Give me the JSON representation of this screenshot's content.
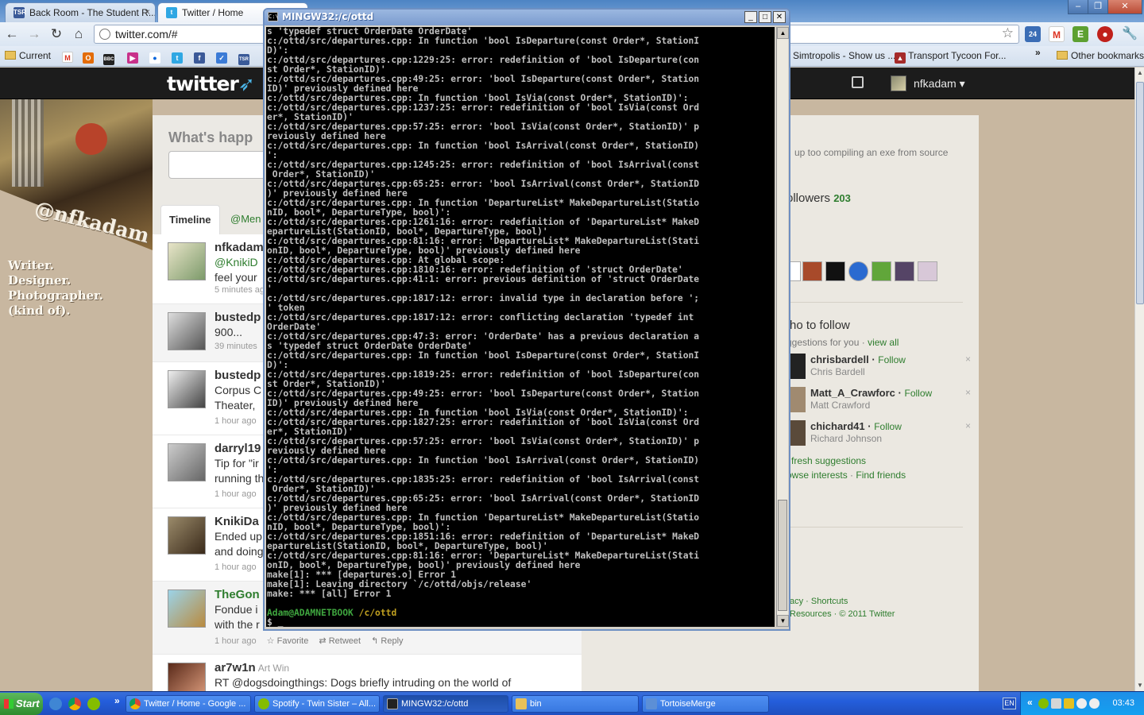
{
  "browser": {
    "tabs": [
      {
        "label": "Back Room - The Student R...",
        "icon": "tsr-icon",
        "color": "#3a5a98"
      },
      {
        "label": "Twitter / Home",
        "icon": "twitter-bird-icon",
        "color": "#2fa7e3"
      }
    ],
    "url": "twitter.com/#",
    "bookmarks": {
      "current": "Current",
      "simtropolis": "Simtropolis - Show us ...",
      "transport": "Transport Tycoon For...",
      "chevron": "»",
      "other": "Other bookmarks"
    },
    "extension_badge": "24"
  },
  "twitter": {
    "logo": "twitter",
    "account": "nfkadam",
    "profile": {
      "handle": "@nfkadam",
      "bio_lines": [
        "Writer.",
        "Designer.",
        "Photographer.",
        "(kind of)."
      ]
    },
    "whats_happening": "What's happ",
    "tabs": {
      "timeline": "Timeline",
      "mentions": "@Men"
    },
    "tweets": [
      {
        "name": "nfkadam",
        "lines": [
          "@KnikiD",
          "feel your"
        ],
        "time": "5 minutes ag",
        "highlight": false
      },
      {
        "name": "bustedp",
        "lines": [
          "900..."
        ],
        "time": "39 minutes",
        "highlight": true
      },
      {
        "name": "bustedp",
        "lines": [
          "Corpus C",
          "Theater,"
        ],
        "time": "1 hour ago",
        "highlight": false
      },
      {
        "name": "darryl19",
        "lines": [
          "Tip for \"ir",
          "running th"
        ],
        "time": "1 hour ago",
        "highlight": false
      },
      {
        "name": "KnikiDa",
        "lines": [
          "Ended up",
          "and doing"
        ],
        "time": "1 hour ago",
        "highlight": false
      },
      {
        "name": "TheGon",
        "lines": [
          "Fondue i",
          "with the r"
        ],
        "time": "1 hour ago",
        "highlight": true,
        "actions": [
          "Favorite",
          "Retweet",
          "Reply"
        ]
      },
      {
        "name": "ar7w1n",
        "realname": "Art Win",
        "lines": [
          "RT @dogsdoingthings: Dogs briefly intruding on the world of"
        ],
        "time": "",
        "highlight": false
      }
    ],
    "dashboard": {
      "latest_tweet_tail": "up too compiling an exe from source",
      "followers_label": "ollowers",
      "followers_count": "203",
      "who_to_follow": "ho to follow",
      "suggestions": "ggestions for you",
      "view_all": "view all",
      "follow_label": "Follow",
      "people": [
        {
          "user": "chrisbardell",
          "real": "Chris Bardell"
        },
        {
          "user": "Matt_A_Crawforc",
          "real": "Matt Crawford"
        },
        {
          "user": "chichard41",
          "real": "Richard Johnson"
        }
      ],
      "refresh": "fresh suggestions",
      "browse": "owse interests",
      "find_friends": "Find friends",
      "footer1": "acy · Shortcuts",
      "footer2": "Resources · © 2011 Twitter"
    }
  },
  "console": {
    "title": "MINGW32:/c/ottd",
    "lines": [
      "s 'typedef struct OrderDate OrderDate'",
      "c:/ottd/src/departures.cpp: In function 'bool IsDeparture(const Order*, StationI",
      "D)':",
      "c:/ottd/src/departures.cpp:1229:25: error: redefinition of 'bool IsDeparture(con",
      "st Order*, StationID)'",
      "c:/ottd/src/departures.cpp:49:25: error: 'bool IsDeparture(const Order*, Station",
      "ID)' previously defined here",
      "c:/ottd/src/departures.cpp: In function 'bool IsVia(const Order*, StationID)':",
      "c:/ottd/src/departures.cpp:1237:25: error: redefinition of 'bool IsVia(const Ord",
      "er*, StationID)'",
      "c:/ottd/src/departures.cpp:57:25: error: 'bool IsVia(const Order*, StationID)' p",
      "reviously defined here",
      "c:/ottd/src/departures.cpp: In function 'bool IsArrival(const Order*, StationID)",
      "':",
      "c:/ottd/src/departures.cpp:1245:25: error: redefinition of 'bool IsArrival(const",
      " Order*, StationID)'",
      "c:/ottd/src/departures.cpp:65:25: error: 'bool IsArrival(const Order*, StationID",
      ")' previously defined here",
      "c:/ottd/src/departures.cpp: In function 'DepartureList* MakeDepartureList(Statio",
      "nID, bool*, DepartureType, bool)':",
      "c:/ottd/src/departures.cpp:1261:16: error: redefinition of 'DepartureList* MakeD",
      "epartureList(StationID, bool*, DepartureType, bool)'",
      "c:/ottd/src/departures.cpp:81:16: error: 'DepartureList* MakeDepartureList(Stati",
      "onID, bool*, DepartureType, bool)' previously defined here",
      "c:/ottd/src/departures.cpp: At global scope:",
      "c:/ottd/src/departures.cpp:1810:16: error: redefinition of 'struct OrderDate'",
      "c:/ottd/src/departures.cpp:41:1: error: previous definition of 'struct OrderDate",
      "'",
      "c:/ottd/src/departures.cpp:1817:12: error: invalid type in declaration before ';",
      "' token",
      "c:/ottd/src/departures.cpp:1817:12: error: conflicting declaration 'typedef int",
      "OrderDate'",
      "c:/ottd/src/departures.cpp:47:3: error: 'OrderDate' has a previous declaration a",
      "s 'typedef struct OrderDate OrderDate'",
      "c:/ottd/src/departures.cpp: In function 'bool IsDeparture(const Order*, StationI",
      "D)':",
      "c:/ottd/src/departures.cpp:1819:25: error: redefinition of 'bool IsDeparture(con",
      "st Order*, StationID)'",
      "c:/ottd/src/departures.cpp:49:25: error: 'bool IsDeparture(const Order*, Station",
      "ID)' previously defined here",
      "c:/ottd/src/departures.cpp: In function 'bool IsVia(const Order*, StationID)':",
      "c:/ottd/src/departures.cpp:1827:25: error: redefinition of 'bool IsVia(const Ord",
      "er*, StationID)'",
      "c:/ottd/src/departures.cpp:57:25: error: 'bool IsVia(const Order*, StationID)' p",
      "reviously defined here",
      "c:/ottd/src/departures.cpp: In function 'bool IsArrival(const Order*, StationID)",
      "':",
      "c:/ottd/src/departures.cpp:1835:25: error: redefinition of 'bool IsArrival(const",
      " Order*, StationID)'",
      "c:/ottd/src/departures.cpp:65:25: error: 'bool IsArrival(const Order*, StationID",
      ")' previously defined here",
      "c:/ottd/src/departures.cpp: In function 'DepartureList* MakeDepartureList(Statio",
      "nID, bool*, DepartureType, bool)':",
      "c:/ottd/src/departures.cpp:1851:16: error: redefinition of 'DepartureList* MakeD",
      "epartureList(StationID, bool*, DepartureType, bool)'",
      "c:/ottd/src/departures.cpp:81:16: error: 'DepartureList* MakeDepartureList(Stati",
      "onID, bool*, DepartureType, bool)' previously defined here",
      "make[1]: *** [departures.o] Error 1",
      "make[1]: Leaving directory `/c/ottd/objs/release'",
      "make: *** [all] Error 1",
      ""
    ],
    "prompt_user": "Adam@ADAMNETBOOK",
    "prompt_path": "/c/ottd",
    "prompt_symbol": "$ _"
  },
  "taskbar": {
    "start": "Start",
    "chevron": "»",
    "tasks": [
      {
        "label": "Twitter / Home - Google ...",
        "icon": "chrome-icon",
        "color": "#dd4b39"
      },
      {
        "label": "Spotify - Twin Sister – All...",
        "icon": "spotify-icon",
        "color": "#84bd00"
      },
      {
        "label": "MINGW32:/c/ottd",
        "icon": "console-icon",
        "color": "#222222"
      },
      {
        "label": "bin",
        "icon": "folder-icon",
        "color": "#e8c15a"
      },
      {
        "label": "TortoiseMerge",
        "icon": "tortoise-icon",
        "color": "#5c8fd6"
      }
    ],
    "language": "EN",
    "tray_chevron": "«",
    "clock": "03:43"
  }
}
